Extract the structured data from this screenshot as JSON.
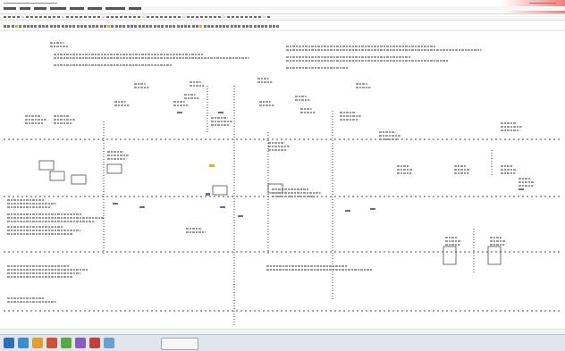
{
  "app": {
    "kind": "cad-drawing-viewer",
    "watermark_color": "#e05050"
  },
  "toolbars": {
    "icons": [
      "new-icon",
      "open-icon",
      "save-icon",
      "print-icon",
      "zoom-icon",
      "pan-icon",
      "layer-icon",
      "measure-icon"
    ]
  },
  "drawing": {
    "title": "",
    "notes_left": [],
    "notes_right": [],
    "legend_lines": [],
    "line_color": "#111111",
    "accent_yellow": "#e0b030",
    "accent_blue": "#5078b0"
  },
  "taskbar": {
    "apps": [
      "start-icon",
      "explorer-icon",
      "browser-icon",
      "mail-icon",
      "folder-icon",
      "media-icon",
      "cad-app-icon",
      "viewer-icon"
    ],
    "tray_text": ""
  }
}
